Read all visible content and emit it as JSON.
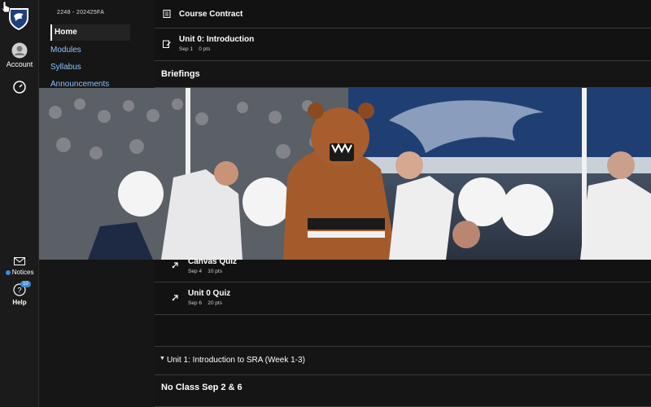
{
  "rail": {
    "account_label": "Account",
    "notices_label": "Notices",
    "help_label": "Help",
    "help_badge": "10"
  },
  "course_nav": {
    "term": "2248 - 202425FA",
    "items": [
      {
        "label": "Home"
      },
      {
        "label": "Modules"
      },
      {
        "label": "Syllabus"
      },
      {
        "label": "Announcements"
      }
    ]
  },
  "modules": {
    "items_top": [
      {
        "title": "Course Contract",
        "meta": ""
      },
      {
        "title": "Unit 0: Introduction",
        "meta_date": "Sep 1",
        "meta_pts": "0 pts"
      }
    ],
    "briefings_header": "Briefings",
    "items_mid": [
      {
        "title": "Canvas Quiz",
        "meta_date": "Sep 4",
        "meta_pts": "10 pts"
      },
      {
        "title": "Unit 0 Quiz",
        "meta_date": "Sep 6",
        "meta_pts": "20 pts"
      }
    ],
    "unit1_header": "Unit 1: Introduction to SRA (Week 1-3)",
    "no_class_header": "No Class Sep 2 & 6"
  },
  "colors": {
    "link": "#8fc3ff",
    "background": "#121212",
    "rail": "#1b1b1b",
    "badge": "#3d8bd8"
  }
}
